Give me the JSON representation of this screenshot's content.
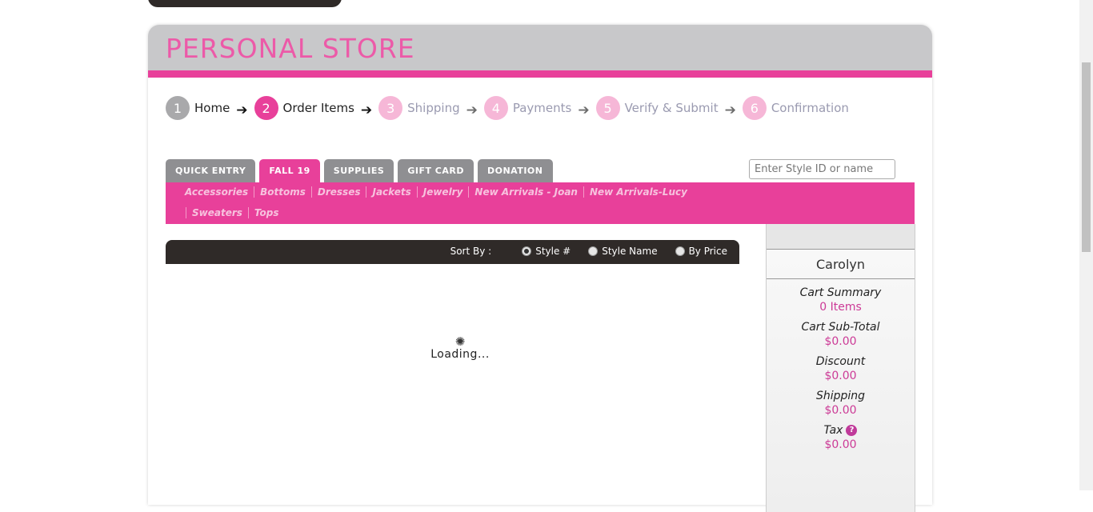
{
  "header": {
    "title": "PERSONAL STORE"
  },
  "steps": [
    {
      "num": "1",
      "label": "Home"
    },
    {
      "num": "2",
      "label": "Order Items"
    },
    {
      "num": "3",
      "label": "Shipping"
    },
    {
      "num": "4",
      "label": "Payments"
    },
    {
      "num": "5",
      "label": "Verify & Submit"
    },
    {
      "num": "6",
      "label": "Confirmation"
    }
  ],
  "tabs": [
    "QUICK ENTRY",
    "FALL 19",
    "SUPPLIES",
    "GIFT CARD",
    "DONATION"
  ],
  "active_tab": "FALL 19",
  "search": {
    "placeholder": "Enter Style ID or name"
  },
  "categories": {
    "row1": [
      "Accessories",
      "Bottoms",
      "Dresses",
      "Jackets",
      "Jewelry",
      "New Arrivals - Joan",
      "New Arrivals-Lucy"
    ],
    "row2": [
      "Sweaters",
      "Tops"
    ]
  },
  "sort": {
    "label": "Sort By :",
    "options": [
      "Style #",
      "Style Name",
      "By Price"
    ],
    "selected": "Style #"
  },
  "loading": {
    "text": "Loading..."
  },
  "sidebar": {
    "name": "Carolyn",
    "cart_summary_label": "Cart Summary",
    "cart_summary_value": "0 Items",
    "subtotal_label": "Cart Sub-Total",
    "subtotal_value": "$0.00",
    "discount_label": "Discount",
    "discount_value": "$0.00",
    "shipping_label": "Shipping",
    "shipping_value": "$0.00",
    "tax_label": "Tax",
    "tax_value": "$0.00",
    "help_glyph": "?"
  },
  "colors": {
    "accent": "#e8409a",
    "dark_bar": "#2f2a28",
    "tab_gray": "#8f8f92"
  }
}
